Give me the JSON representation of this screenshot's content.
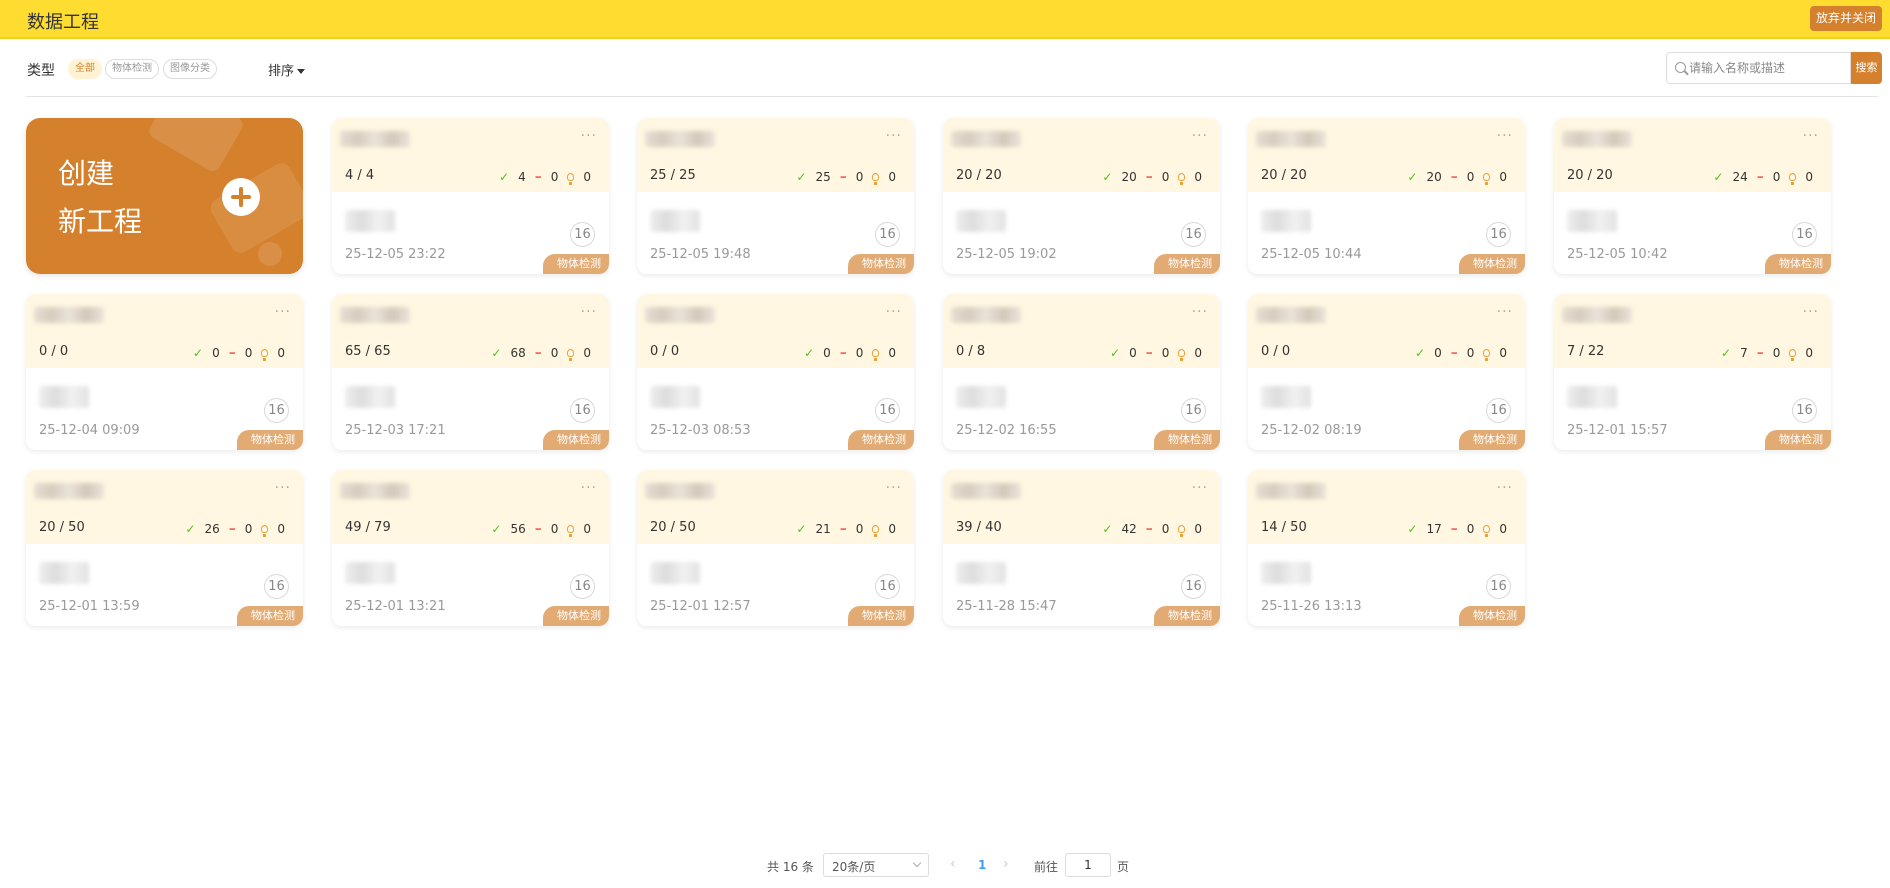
{
  "header": {
    "title": "数据工程",
    "close_label": "放弃并关闭"
  },
  "filters": {
    "type_label": "类型",
    "chips": [
      "全部",
      "物体检测",
      "图像分类"
    ],
    "sort_label": "排序",
    "search_placeholder": "请输入名称或描述",
    "search_button": "搜索"
  },
  "create_card": {
    "line1": "创建",
    "line2": "新工程"
  },
  "projects": [
    {
      "progress": "4 / 4",
      "ok": "4",
      "minus": "0",
      "idea": "0",
      "count": "16",
      "date": "25-12-05 23:22",
      "tag": "物体检测"
    },
    {
      "progress": "25 / 25",
      "ok": "25",
      "minus": "0",
      "idea": "0",
      "count": "16",
      "date": "25-12-05 19:48",
      "tag": "物体检测"
    },
    {
      "progress": "20 / 20",
      "ok": "20",
      "minus": "0",
      "idea": "0",
      "count": "16",
      "date": "25-12-05 19:02",
      "tag": "物体检测"
    },
    {
      "progress": "20 / 20",
      "ok": "20",
      "minus": "0",
      "idea": "0",
      "count": "16",
      "date": "25-12-05 10:44",
      "tag": "物体检测"
    },
    {
      "progress": "20 / 20",
      "ok": "24",
      "minus": "0",
      "idea": "0",
      "count": "16",
      "date": "25-12-05 10:42",
      "tag": "物体检测"
    },
    {
      "progress": "0 / 0",
      "ok": "0",
      "minus": "0",
      "idea": "0",
      "count": "16",
      "date": "25-12-04 09:09",
      "tag": "物体检测"
    },
    {
      "progress": "65 / 65",
      "ok": "68",
      "minus": "0",
      "idea": "0",
      "count": "16",
      "date": "25-12-03 17:21",
      "tag": "物体检测"
    },
    {
      "progress": "0 / 0",
      "ok": "0",
      "minus": "0",
      "idea": "0",
      "count": "16",
      "date": "25-12-03 08:53",
      "tag": "物体检测"
    },
    {
      "progress": "0 / 8",
      "ok": "0",
      "minus": "0",
      "idea": "0",
      "count": "16",
      "date": "25-12-02 16:55",
      "tag": "物体检测"
    },
    {
      "progress": "0 / 0",
      "ok": "0",
      "minus": "0",
      "idea": "0",
      "count": "16",
      "date": "25-12-02 08:19",
      "tag": "物体检测"
    },
    {
      "progress": "7 / 22",
      "ok": "7",
      "minus": "0",
      "idea": "0",
      "count": "16",
      "date": "25-12-01 15:57",
      "tag": "物体检测"
    },
    {
      "progress": "20 / 50",
      "ok": "26",
      "minus": "0",
      "idea": "0",
      "count": "16",
      "date": "25-12-01 13:59",
      "tag": "物体检测"
    },
    {
      "progress": "49 / 79",
      "ok": "56",
      "minus": "0",
      "idea": "0",
      "count": "16",
      "date": "25-12-01 13:21",
      "tag": "物体检测"
    },
    {
      "progress": "20 / 50",
      "ok": "21",
      "minus": "0",
      "idea": "0",
      "count": "16",
      "date": "25-12-01 12:57",
      "tag": "物体检测"
    },
    {
      "progress": "39 / 40",
      "ok": "42",
      "minus": "0",
      "idea": "0",
      "count": "16",
      "date": "25-11-28 15:47",
      "tag": "物体检测"
    },
    {
      "progress": "14 / 50",
      "ok": "17",
      "minus": "0",
      "idea": "0",
      "count": "16",
      "date": "25-11-26 13:13",
      "tag": "物体检测"
    }
  ],
  "pagination": {
    "total": "共 16 条",
    "page_size": "20条/页",
    "current_page": "1",
    "goto_label": "前往",
    "goto_value": "1",
    "goto_unit": "页"
  }
}
